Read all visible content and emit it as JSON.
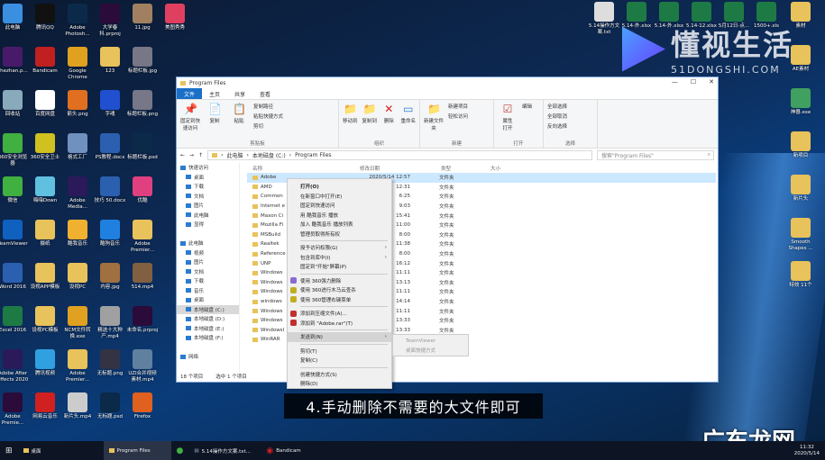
{
  "desktop_left": [
    [
      [
        "此电脑",
        "#3b8fe0"
      ],
      [
        "腾讯QQ",
        "#111"
      ],
      [
        "Adobe Photosh...",
        "#0b2a4a"
      ],
      [
        "大学春科.prproj",
        "#2a0b3a"
      ],
      [
        "11.jpg",
        "#a08060"
      ],
      [
        "美图秀秀",
        "#e04060"
      ]
    ],
    [
      [
        "zhezhan.p...",
        "#4a1a6a"
      ],
      [
        "Bandicam",
        "#c02020"
      ],
      [
        "Google Chrome",
        "#e0a020"
      ],
      [
        "123",
        "#e8c25a"
      ],
      [
        "标题栏板.jpg",
        "#778"
      ]
    ],
    [
      [
        "回收站",
        "#8ab"
      ],
      [
        "百度网盘",
        "#fff"
      ],
      [
        "箭头.png",
        "#e07020"
      ],
      [
        "字魂",
        "#2050d0"
      ],
      [
        "标题栏板.png",
        "#778"
      ]
    ],
    [
      [
        "360安全浏览器",
        "#40b040"
      ],
      [
        "360安全卫士",
        "#d0c020"
      ],
      [
        "格式工厂",
        "#7090c0"
      ],
      [
        "PS教程.docx",
        "#2b5fb0"
      ],
      [
        "标题栏板.psd",
        "#0b2a4a"
      ]
    ],
    [
      [
        "微信",
        "#40b040"
      ],
      [
        "嗨嗨Down",
        "#60c0e0"
      ],
      [
        "Adobe Media...",
        "#2a1a5a"
      ],
      [
        "技巧 50.docx",
        "#2b5fb0"
      ],
      [
        "优酷",
        "#e04080"
      ]
    ],
    [
      [
        "TeamViewer",
        "#1060c0"
      ],
      [
        "摄纸",
        "#e8c25a"
      ],
      [
        "酷我音乐",
        "#f0b030"
      ],
      [
        "酷狗音乐",
        "#2080e0"
      ],
      [
        "Adobe Premier...",
        "#e8c25a"
      ]
    ],
    [
      [
        "Word 2016",
        "#2b5fb0"
      ],
      [
        "设视APP模板",
        "#e8c25a"
      ],
      [
        "设视PC",
        "#e8c25a"
      ],
      [
        "内容.jpg",
        "#a07040"
      ],
      [
        "514.mp4",
        "#806040"
      ]
    ],
    [
      [
        "Excel 2016",
        "#1d7a44"
      ],
      [
        "设视PC模板",
        "#e8c25a"
      ],
      [
        "NCM文件转换.exe",
        "#e0a020"
      ],
      [
        "精选十大种产.mp4",
        "#a0a0a0"
      ],
      [
        "未命名.prproj",
        "#2a0b3a"
      ]
    ],
    [
      [
        "Adobe After Effects 2020",
        "#2a1a5a"
      ],
      [
        "腾讯视频",
        "#30a0e0"
      ],
      [
        "Adobe Premier...",
        "#e8c25a"
      ],
      [
        "无标题.png",
        "#334"
      ],
      [
        "UZI合并视频素材.mp4",
        "#6080a0"
      ]
    ],
    [
      [
        "Adobe Premie...",
        "#2a0b3a"
      ],
      [
        "网易云音乐",
        "#d02020"
      ],
      [
        "新片头.mp4",
        "#ccc"
      ],
      [
        "无标题.psd",
        "#0b2a4a"
      ],
      [
        "Firefox",
        "#e06020"
      ]
    ]
  ],
  "desktop_top": [
    [
      "5.14操作方文案.txt",
      "#ddd"
    ],
    [
      "5.14-外.xlsx",
      "#1d7a44"
    ],
    [
      "5.14-外.xlsx",
      "#1d7a44"
    ],
    [
      "5.14-12.xlsx",
      "#1d7a44"
    ],
    [
      "5月12日-点...",
      "#1d7a44"
    ],
    [
      "1500+.xls",
      "#1d7a44"
    ]
  ],
  "desktop_right": [
    [
      "素材",
      "#e8c25a"
    ],
    [
      "AE素材",
      "#e8c25a"
    ],
    [
      "神器.exe",
      "#40a060"
    ],
    [
      "新项目",
      "#e8c25a"
    ],
    [
      "新片头",
      "#e8c25a"
    ],
    [
      "Smooth Shapes ...",
      "#e8c25a"
    ],
    [
      "特效 11个",
      "#e8c25a"
    ]
  ],
  "window": {
    "title": "Program Files",
    "tabs": [
      "文件",
      "主页",
      "共享",
      "查看"
    ],
    "ribbon": {
      "pin": "固定到快速访问",
      "copy": "复制",
      "paste": "粘贴",
      "copy_path": "复制路径",
      "paste_shortcut": "粘贴快捷方式",
      "cut": "剪切",
      "clipboard": "剪贴板",
      "move_to": "移动到",
      "copy_to": "复制到",
      "delete": "删除",
      "rename": "重命名",
      "organize": "组织",
      "new_folder": "新建文件夹",
      "new_item": "新建项目",
      "easy_access": "轻松访问",
      "new": "新建",
      "properties": "属性",
      "open": "打开",
      "edit": "编辑",
      "open_group": "打开",
      "select_all": "全部选择",
      "select_none": "全部取消",
      "invert": "反向选择",
      "select": "选择"
    },
    "breadcrumb": [
      "此电脑",
      "本地磁盘 (C:)",
      "Program Files"
    ],
    "search_placeholder": "搜索\"Program Files\"",
    "nav": {
      "quick": "快速访问",
      "quick_items": [
        "桌面",
        "下载",
        "文档",
        "图片",
        "此电脑",
        "显得"
      ],
      "pc": "此电脑",
      "pc_items": [
        "视频",
        "图片",
        "文档",
        "下载",
        "音乐",
        "桌面",
        "本地磁盘 (C:)",
        "本地磁盘 (D:)",
        "本地磁盘 (E:)",
        "本地磁盘 (F:)"
      ],
      "network": "网络"
    },
    "columns": [
      "名称",
      "修改日期",
      "类型",
      "大小"
    ],
    "files": [
      {
        "name": "Adobe",
        "date": "2020/5/14 12:57",
        "type": "文件夹"
      },
      {
        "name": "AMD",
        "date": "12:31",
        "type": "文件夹"
      },
      {
        "name": "Common",
        "date": "6:25",
        "type": "文件夹"
      },
      {
        "name": "Internet e",
        "date": "9:03",
        "type": "文件夹"
      },
      {
        "name": "Maxon Ci",
        "date": "15:41",
        "type": "文件夹"
      },
      {
        "name": "Mozilla Fi",
        "date": "11:00",
        "type": "文件夹"
      },
      {
        "name": "MSBuild",
        "date": "8:00",
        "type": "文件夹"
      },
      {
        "name": "Realtek",
        "date": "11:38",
        "type": "文件夹"
      },
      {
        "name": "Reference",
        "date": "8:00",
        "type": "文件夹"
      },
      {
        "name": "UNP",
        "date": "16:12",
        "type": "文件夹"
      },
      {
        "name": "Windows",
        "date": "11:11",
        "type": "文件夹"
      },
      {
        "name": "Windows",
        "date": "13:13",
        "type": "文件夹"
      },
      {
        "name": "Windows",
        "date": "11:11",
        "type": "文件夹"
      },
      {
        "name": "windows",
        "date": "14:14",
        "type": "文件夹"
      },
      {
        "name": "Windows",
        "date": "11:11",
        "type": "文件夹"
      },
      {
        "name": "Windows",
        "date": "13:33",
        "type": "文件夹"
      },
      {
        "name": "WindowsI",
        "date": "13:33",
        "type": "文件夹"
      },
      {
        "name": "WinRAR",
        "date": "",
        "type": ""
      }
    ],
    "status_count": "18 个项目",
    "status_selected": "选中 1 个项目"
  },
  "context_menu": [
    {
      "label": "打开(O)",
      "bold": true
    },
    {
      "label": "在新窗口中打开(E)"
    },
    {
      "label": "固定到快速访问"
    },
    {
      "label": "用 酷我音乐 播放"
    },
    {
      "label": "加入 酷我音乐 播放列表"
    },
    {
      "label": "管理员取得所有权"
    },
    {
      "sep": true
    },
    {
      "label": "授予访问权限(G)",
      "arrow": true
    },
    {
      "label": "包含到库中(I)",
      "arrow": true
    },
    {
      "label": "固定到\"开始\"屏幕(P)"
    },
    {
      "sep": true
    },
    {
      "label": "使用 360强力删除",
      "icon": "#8a6ad0"
    },
    {
      "label": "使用 360进行木马云查杀",
      "icon": "#c0b020"
    },
    {
      "label": "使用 360管理右键菜单",
      "icon": "#c0b020"
    },
    {
      "sep": true
    },
    {
      "label": "添加到压缩文件(A)...",
      "icon": "#c03030"
    },
    {
      "label": "添加到 \"Adobe.rar\"(T)",
      "icon": "#c03030"
    },
    {
      "sep": true
    },
    {
      "label": "发送到(N)",
      "arrow": true,
      "hl": true
    },
    {
      "sep": true
    },
    {
      "label": "剪切(T)"
    },
    {
      "label": "复制(C)"
    },
    {
      "sep": true
    },
    {
      "label": "创建快捷方式(S)"
    },
    {
      "label": "删除(D)"
    }
  ],
  "submenu": [
    "TeamViewer",
    "桌面快捷方式"
  ],
  "caption": "4.手动删除不需要的大文件即可",
  "watermark": {
    "cn": "懂视生活",
    "en": "51DONGSHI.COM",
    "bottom": "广东龙网"
  },
  "taskbar": {
    "items": [
      "桌面",
      "Program Files",
      "",
      "5.14操作方文案.txt...",
      "Bandicam"
    ],
    "time": "11:32",
    "date": "2020/5/14"
  }
}
